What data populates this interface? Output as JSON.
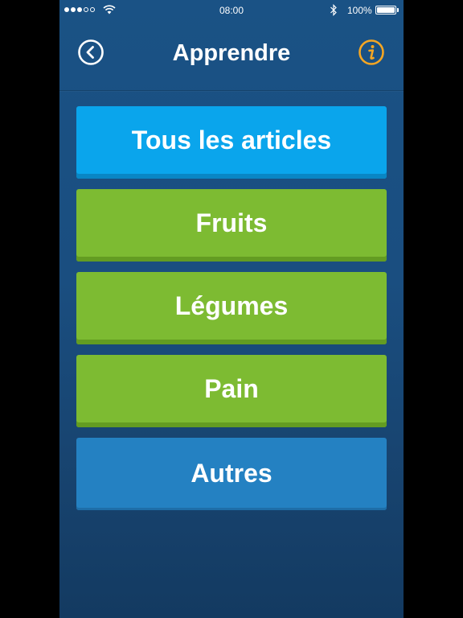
{
  "status_bar": {
    "time": "08:00",
    "battery_percent": "100%",
    "signal_bars_filled": 3,
    "signal_bars_total": 5,
    "icons": [
      "wifi-icon",
      "bluetooth-icon",
      "battery-icon"
    ]
  },
  "nav": {
    "title": "Apprendre",
    "back_icon": "chevron-left-circle-icon",
    "info_icon": "info-circle-icon"
  },
  "colors": {
    "background": "#1a4e80",
    "all_items_button": "#0aa5ec",
    "category_button": "#7dbb32",
    "other_button": "#2481c2",
    "info_accent": "#f5a623"
  },
  "menu": {
    "items": [
      {
        "label": "Tous les articles"
      },
      {
        "label": "Fruits"
      },
      {
        "label": "Légumes"
      },
      {
        "label": "Pain"
      },
      {
        "label": "Autres"
      }
    ]
  }
}
